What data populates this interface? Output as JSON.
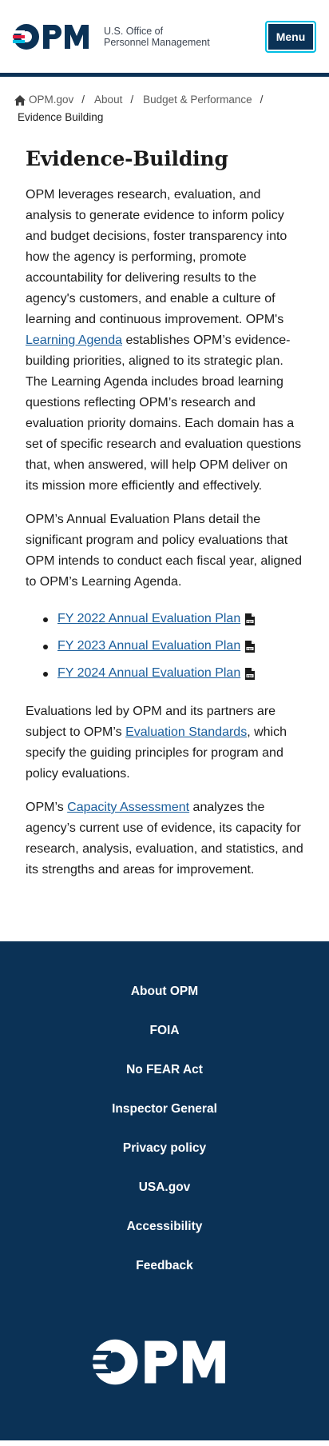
{
  "header": {
    "brand_line1": "U.S. Office of",
    "brand_line2": "Personnel Management",
    "menu_label": "Menu"
  },
  "breadcrumb": {
    "items": [
      "OPM.gov",
      "About",
      "Budget & Performance"
    ],
    "current": "Evidence Building"
  },
  "main": {
    "title": "Evidence-Building",
    "p1_before": "OPM leverages research, evaluation, and analysis to generate evidence to inform policy and budget decisions, foster transparency into how the agency is performing, promote accountability for delivering results to the agency's customers, and enable a culture of learning and continuous improvement. OPM's ",
    "p1_link": "Learning Agenda",
    "p1_after": " establishes OPM’s evidence-building priorities, aligned to its strategic plan. The Learning Agenda includes broad learning questions reflecting OPM’s research and evaluation priority domains. Each domain has a set of specific research and evaluation questions that, when answered, will help OPM deliver on its mission more efficiently and effectively.",
    "p2": "OPM’s Annual Evaluation Plans detail the significant program and policy evaluations that OPM intends to conduct each fiscal year, aligned to OPM’s Learning Agenda.",
    "plans": [
      "FY 2022 Annual Evaluation Plan",
      "FY 2023 Annual Evaluation Plan",
      "FY 2024 Annual Evaluation Plan"
    ],
    "p3_before": "Evaluations led by OPM and its partners are subject to OPM’s ",
    "p3_link": "Evaluation Standards",
    "p3_after": ", which specify the guiding principles for program and policy evaluations.",
    "p4_before": "OPM’s ",
    "p4_link": "Capacity Assessment",
    "p4_after": " analyzes the agency’s current use of evidence, its capacity for research, analysis, evaluation, and statistics, and its strengths and areas for improvement."
  },
  "footer": {
    "links": [
      "About OPM",
      "FOIA",
      "No FEAR Act",
      "Inspector General",
      "Privacy policy",
      "USA.gov",
      "Accessibility",
      "Feedback"
    ]
  },
  "colors": {
    "navy": "#0b3256",
    "link": "#1a5e9c",
    "accent_red": "#e31c3d",
    "accent_cyan": "#00bde3"
  },
  "icons": [
    "opm-logo",
    "home-icon",
    "pdf-icon"
  ]
}
